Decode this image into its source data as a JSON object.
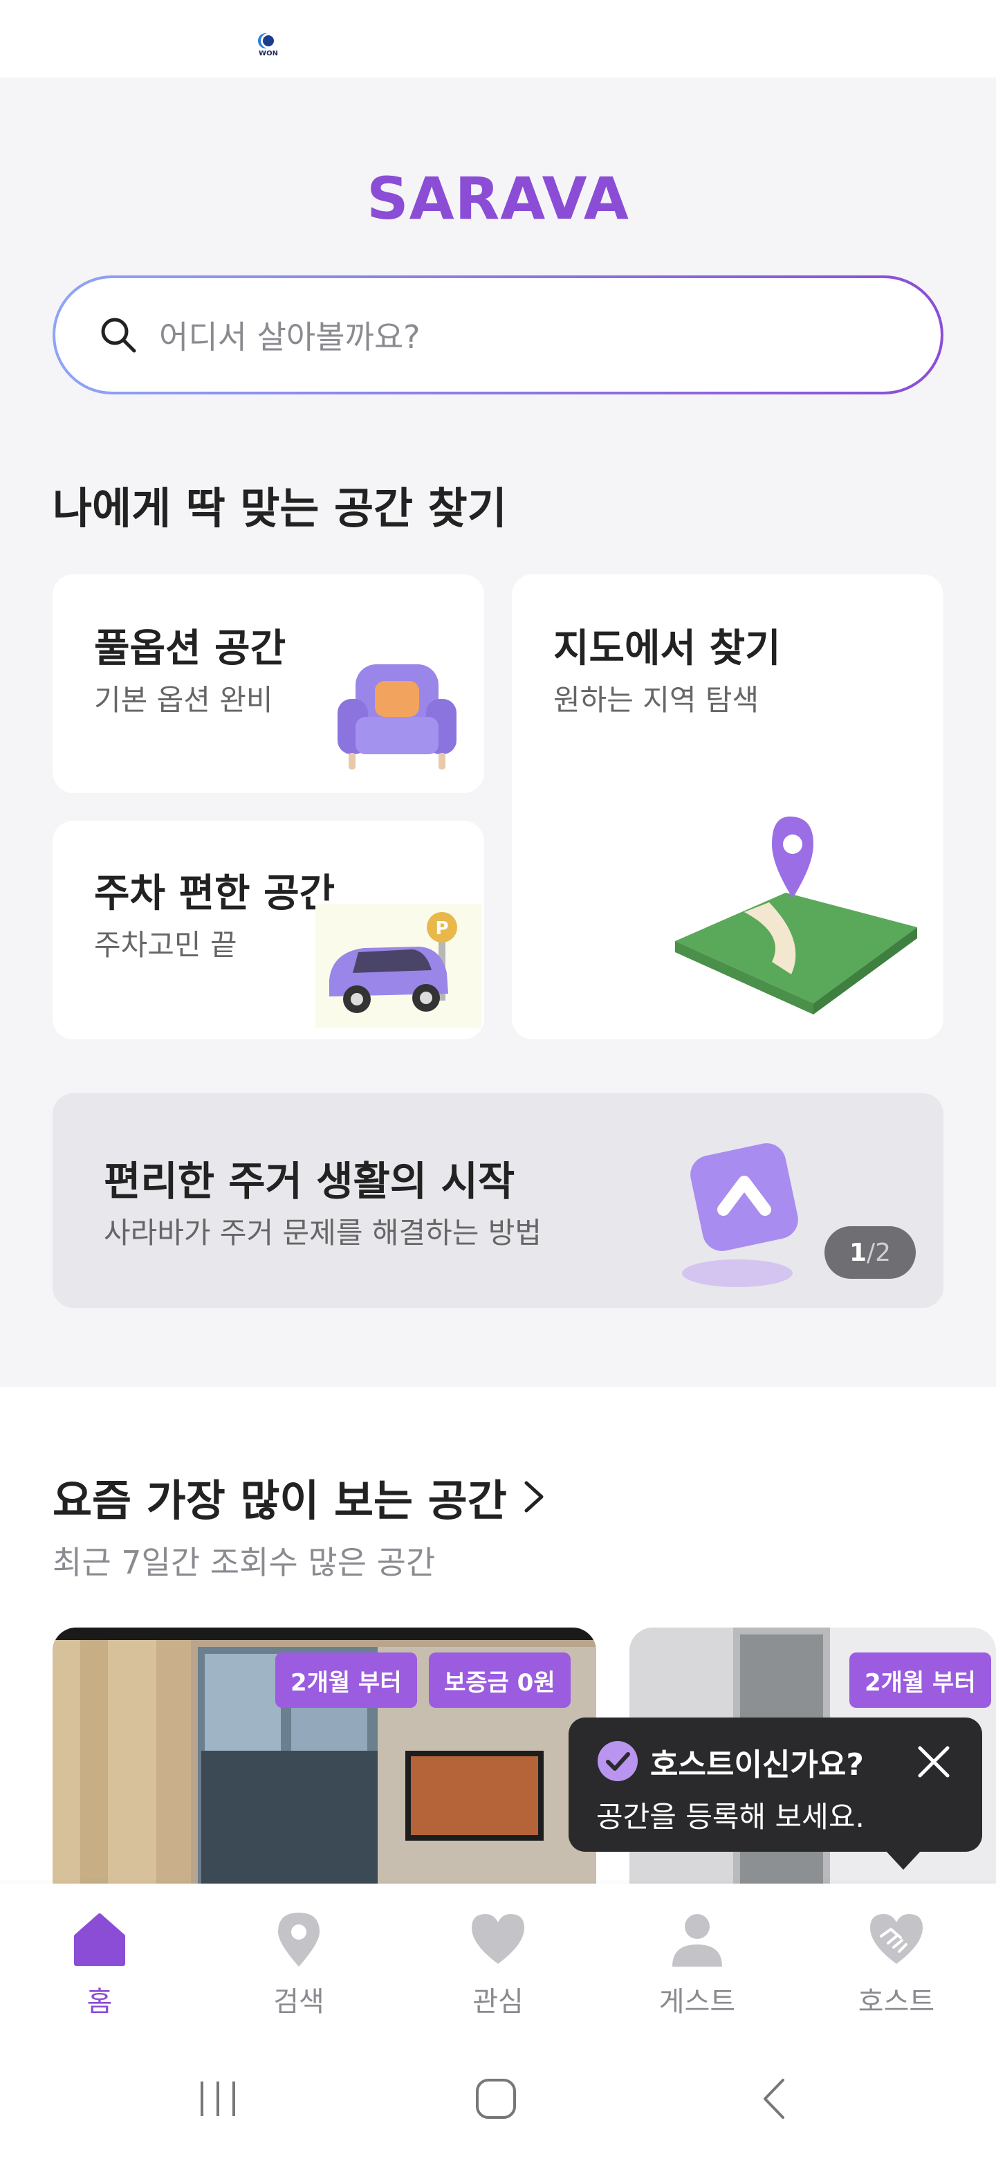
{
  "status_bar": {
    "app_icon_text": "WON"
  },
  "header": {
    "logo": "SARAVA"
  },
  "search": {
    "placeholder": "어디서 살아볼까요?"
  },
  "find_section": {
    "title": "나에게 딱 맞는 공간 찾기",
    "cards": [
      {
        "title": "풀옵션 공간",
        "subtitle": "기본 옵션 완비",
        "icon": "armchair-icon"
      },
      {
        "title": "주차 편한 공간",
        "subtitle": "주차고민 끝",
        "icon": "car-icon"
      },
      {
        "title": "지도에서 찾기",
        "subtitle": "원하는 지역 탐색",
        "icon": "map-pin-icon"
      }
    ]
  },
  "banner": {
    "title": "편리한 주거 생활의 시작",
    "subtitle": "사라바가 주거 문제를 해결하는 방법",
    "page_current": "1",
    "page_separator": " / ",
    "page_total": "2"
  },
  "popular": {
    "title": "요즘 가장 많이 보는 공간",
    "subtitle": "최근 7일간 조회수 많은 공간",
    "listings": [
      {
        "tags": [
          "2개월 부터",
          "보증금 0원"
        ]
      },
      {
        "tags": [
          "2개월 부터"
        ]
      }
    ]
  },
  "host_tooltip": {
    "title": "호스트이신가요?",
    "message": "공간을 등록해 보세요."
  },
  "bottom_nav": {
    "items": [
      {
        "label": "홈",
        "icon": "home-icon",
        "active": true
      },
      {
        "label": "검색",
        "icon": "location-pin-icon",
        "active": false
      },
      {
        "label": "관심",
        "icon": "heart-icon",
        "active": false
      },
      {
        "label": "게스트",
        "icon": "person-icon",
        "active": false
      },
      {
        "label": "호스트",
        "icon": "handshake-icon",
        "active": false
      }
    ]
  },
  "colors": {
    "brand": "#8b4dd6",
    "tag": "#9b5ce0",
    "tooltip_bg": "#2a2a2c",
    "nav_inactive": "#c4c4c8"
  }
}
